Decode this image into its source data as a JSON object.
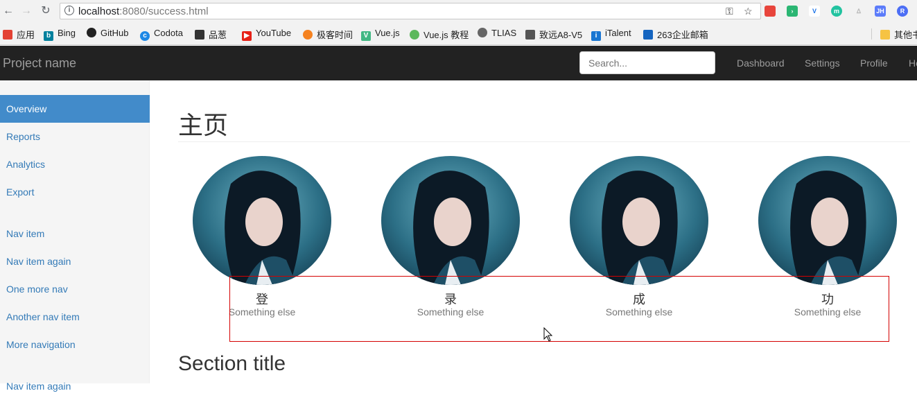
{
  "browser": {
    "url_host": "localhost",
    "url_port_path": ":8080/success.html",
    "bookmarks": [
      {
        "label": "应用",
        "color": "#e34133"
      },
      {
        "label": "Bing",
        "color": "#00809d"
      },
      {
        "label": "GitHub",
        "color": "#222222"
      },
      {
        "label": "Codota",
        "color": "#1e88e5"
      },
      {
        "label": "品葱",
        "color": "#333333"
      },
      {
        "label": "YouTube",
        "color": "#e62117"
      },
      {
        "label": "极客时间",
        "color": "#f58220"
      },
      {
        "label": "Vue.js",
        "color": "#41b883"
      },
      {
        "label": "Vue.js 教程",
        "color": "#5cb85c"
      },
      {
        "label": "TLIAS",
        "color": "#666666"
      },
      {
        "label": "致远A8-V5",
        "color": "#555555"
      },
      {
        "label": "iTalent",
        "color": "#1976d2"
      },
      {
        "label": "263企业邮箱",
        "color": "#1565c0"
      },
      {
        "label": "其他书",
        "color": "#f6c343"
      }
    ]
  },
  "navbar": {
    "brand": "Project name",
    "search_placeholder": "Search...",
    "links": [
      "Dashboard",
      "Settings",
      "Profile",
      "Help"
    ]
  },
  "sidebar": {
    "group1": [
      "Overview",
      "Reports",
      "Analytics",
      "Export"
    ],
    "group2": [
      "Nav item",
      "Nav item again",
      "One more nav",
      "Another nav item",
      "More navigation"
    ],
    "group3": [
      "Nav item again"
    ]
  },
  "main": {
    "title": "主页",
    "placeholders": [
      {
        "title": "登",
        "subtitle": "Something else"
      },
      {
        "title": "录",
        "subtitle": "Something else"
      },
      {
        "title": "成",
        "subtitle": "Something else"
      },
      {
        "title": "功",
        "subtitle": "Something else"
      }
    ],
    "section_title": "Section title"
  }
}
